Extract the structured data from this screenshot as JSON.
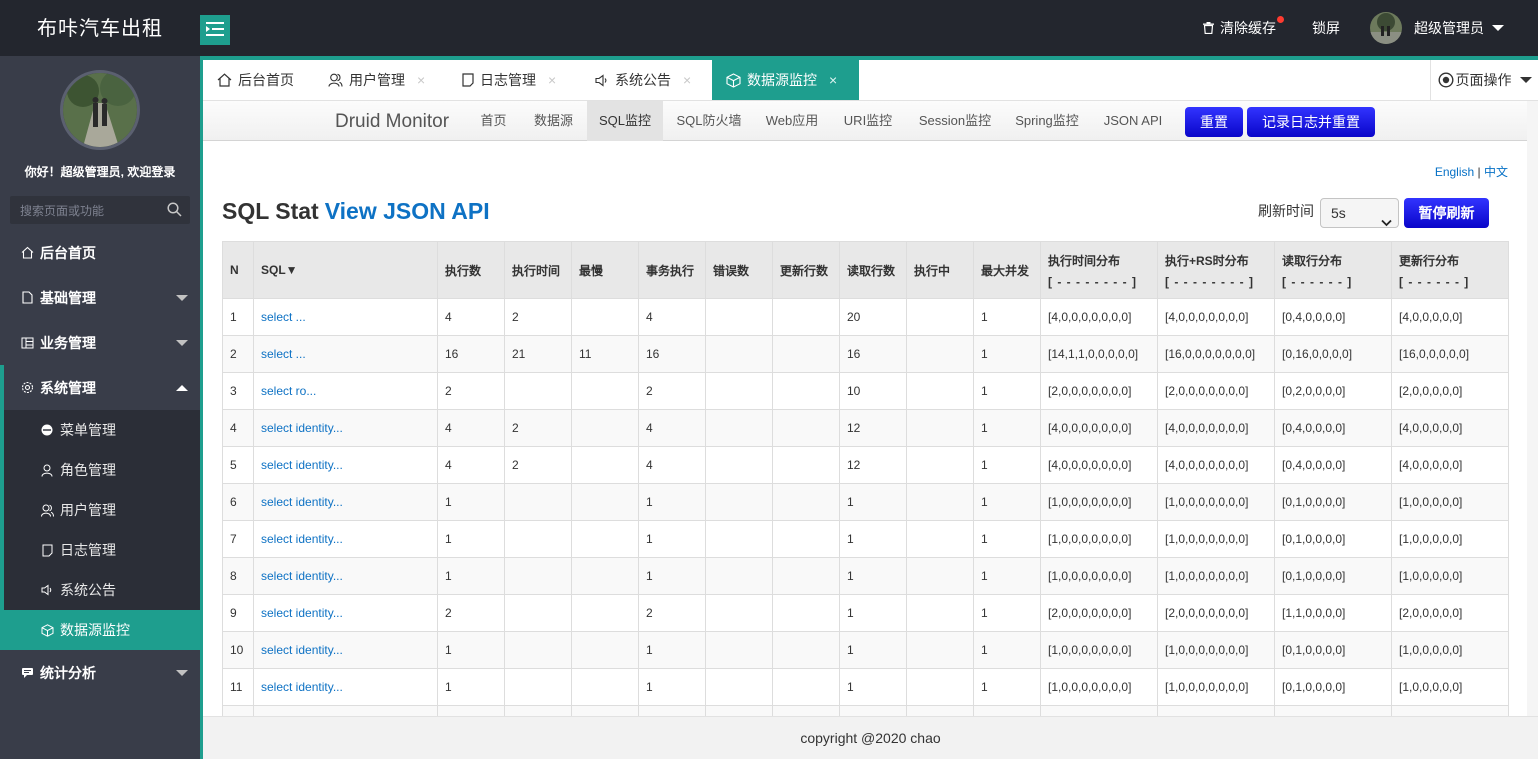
{
  "header": {
    "app_title": "布咔汽车出租",
    "clear_cache": "清除缓存",
    "lock_screen": "锁屏",
    "user_name": "超级管理员",
    "accent_color": "#1e9e8e",
    "badge_color": "#ff3b30"
  },
  "sidebar": {
    "welcome": "你好！超级管理员, 欢迎登录",
    "search_placeholder": "搜索页面或功能",
    "items": [
      {
        "label": "后台首页",
        "icon": "home-icon"
      },
      {
        "label": "基础管理",
        "icon": "file-icon"
      },
      {
        "label": "业务管理",
        "icon": "grid-icon"
      },
      {
        "label": "系统管理",
        "icon": "gear-icon"
      },
      {
        "label": "统计分析",
        "icon": "chat-icon"
      }
    ],
    "sub_items": [
      {
        "label": "菜单管理",
        "icon": "circle-icon"
      },
      {
        "label": "角色管理",
        "icon": "user-icon"
      },
      {
        "label": "用户管理",
        "icon": "users-icon"
      },
      {
        "label": "日志管理",
        "icon": "note-icon"
      },
      {
        "label": "系统公告",
        "icon": "speaker-icon"
      },
      {
        "label": "数据源监控",
        "icon": "cube-icon"
      }
    ]
  },
  "tabs": [
    {
      "label": "后台首页"
    },
    {
      "label": "用户管理"
    },
    {
      "label": "日志管理"
    },
    {
      "label": "系统公告"
    },
    {
      "label": "数据源监控"
    }
  ],
  "tab_close": "×",
  "page_ops": "页面操作",
  "druid": {
    "brand": "Druid Monitor",
    "nav": [
      "首页",
      "数据源",
      "SQL监控",
      "SQL防火墙",
      "Web应用",
      "URI监控",
      "Session监控",
      "Spring监控",
      "JSON API"
    ],
    "reset": "重置",
    "log_reset": "记录日志并重置",
    "lang_en": "English",
    "lang_sep": "|",
    "lang_zh": "中文",
    "title": "SQL Stat",
    "title_link": "View JSON API",
    "refresh_label": "刷新时间",
    "refresh_value": "5s",
    "pause": "暂停刷新",
    "button_color": "#0905c9",
    "link_color": "#0e72c4"
  },
  "table": {
    "headers": [
      "N",
      "SQL▼",
      "执行数",
      "执行时间",
      "最慢",
      "事务执行",
      "错误数",
      "更新行数",
      "读取行数",
      "执行中",
      "最大并发",
      "执行时间分布",
      "执行+RS时分布",
      "读取行分布",
      "更新行分布"
    ],
    "header_subs": [
      "",
      "",
      "",
      "",
      "",
      "",
      "",
      "",
      "",
      "",
      "",
      "[ - - - - - - - - ]",
      "[ - - - - - - - - ]",
      "[ - - - - - - ]",
      "[ - - - - - - ]"
    ],
    "rows": [
      [
        "1",
        "select ...",
        "4",
        "2",
        "",
        "4",
        "",
        "",
        "20",
        "",
        "1",
        "[4,0,0,0,0,0,0,0]",
        "[4,0,0,0,0,0,0,0]",
        "[0,4,0,0,0,0]",
        "[4,0,0,0,0,0]"
      ],
      [
        "2",
        "select ...",
        "16",
        "21",
        "11",
        "16",
        "",
        "",
        "16",
        "",
        "1",
        "[14,1,1,0,0,0,0,0]",
        "[16,0,0,0,0,0,0,0]",
        "[0,16,0,0,0,0]",
        "[16,0,0,0,0,0]"
      ],
      [
        "3",
        "select ro...",
        "2",
        "",
        "",
        "2",
        "",
        "",
        "10",
        "",
        "1",
        "[2,0,0,0,0,0,0,0]",
        "[2,0,0,0,0,0,0,0]",
        "[0,2,0,0,0,0]",
        "[2,0,0,0,0,0]"
      ],
      [
        "4",
        "select identity...",
        "4",
        "2",
        "",
        "4",
        "",
        "",
        "12",
        "",
        "1",
        "[4,0,0,0,0,0,0,0]",
        "[4,0,0,0,0,0,0,0]",
        "[0,4,0,0,0,0]",
        "[4,0,0,0,0,0]"
      ],
      [
        "5",
        "select identity...",
        "4",
        "2",
        "",
        "4",
        "",
        "",
        "12",
        "",
        "1",
        "[4,0,0,0,0,0,0,0]",
        "[4,0,0,0,0,0,0,0]",
        "[0,4,0,0,0,0]",
        "[4,0,0,0,0,0]"
      ],
      [
        "6",
        "select identity...",
        "1",
        "",
        "",
        "1",
        "",
        "",
        "1",
        "",
        "1",
        "[1,0,0,0,0,0,0,0]",
        "[1,0,0,0,0,0,0,0]",
        "[0,1,0,0,0,0]",
        "[1,0,0,0,0,0]"
      ],
      [
        "7",
        "select identity...",
        "1",
        "",
        "",
        "1",
        "",
        "",
        "1",
        "",
        "1",
        "[1,0,0,0,0,0,0,0]",
        "[1,0,0,0,0,0,0,0]",
        "[0,1,0,0,0,0]",
        "[1,0,0,0,0,0]"
      ],
      [
        "8",
        "select identity...",
        "1",
        "",
        "",
        "1",
        "",
        "",
        "1",
        "",
        "1",
        "[1,0,0,0,0,0,0,0]",
        "[1,0,0,0,0,0,0,0]",
        "[0,1,0,0,0,0]",
        "[1,0,0,0,0,0]"
      ],
      [
        "9",
        "select identity...",
        "2",
        "",
        "",
        "2",
        "",
        "",
        "1",
        "",
        "1",
        "[2,0,0,0,0,0,0,0]",
        "[2,0,0,0,0,0,0,0]",
        "[1,1,0,0,0,0]",
        "[2,0,0,0,0,0]"
      ],
      [
        "10",
        "select identity...",
        "1",
        "",
        "",
        "1",
        "",
        "",
        "1",
        "",
        "1",
        "[1,0,0,0,0,0,0,0]",
        "[1,0,0,0,0,0,0,0]",
        "[0,1,0,0,0,0]",
        "[1,0,0,0,0,0]"
      ],
      [
        "11",
        "select identity...",
        "1",
        "",
        "",
        "1",
        "",
        "",
        "1",
        "",
        "1",
        "[1,0,0,0,0,0,0,0]",
        "[1,0,0,0,0,0,0,0]",
        "[0,1,0,0,0,0]",
        "[1,0,0,0,0,0]"
      ],
      [
        "",
        "",
        "",
        "",
        "",
        "",
        "",
        "",
        "",
        "",
        "",
        "",
        "",
        "",
        ""
      ]
    ]
  },
  "footer": {
    "copyright": "copyright @2020 chao"
  }
}
